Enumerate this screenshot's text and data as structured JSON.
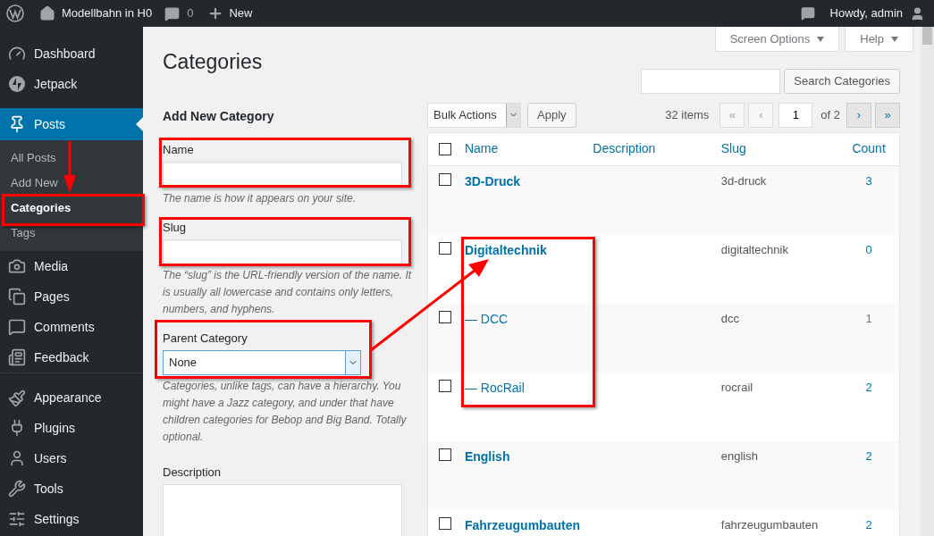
{
  "admin_bar": {
    "site_name": "Modellbahn in H0",
    "comments_count": "0",
    "new_label": "New",
    "greeting": "Howdy, admin"
  },
  "sidebar": {
    "items": [
      {
        "label": "Dashboard",
        "selected": false
      },
      {
        "label": "Jetpack",
        "selected": false
      },
      {
        "label": "Posts",
        "selected": true,
        "children": [
          {
            "label": "All Posts",
            "selected": false
          },
          {
            "label": "Add New",
            "selected": false
          },
          {
            "label": "Categories",
            "selected": true
          },
          {
            "label": "Tags",
            "selected": false
          }
        ]
      },
      {
        "label": "Media",
        "selected": false
      },
      {
        "label": "Pages",
        "selected": false
      },
      {
        "label": "Comments",
        "selected": false
      },
      {
        "label": "Feedback",
        "selected": false
      },
      {
        "label": "Appearance",
        "selected": false,
        "separator_before": true
      },
      {
        "label": "Plugins",
        "selected": false
      },
      {
        "label": "Users",
        "selected": false
      },
      {
        "label": "Tools",
        "selected": false
      },
      {
        "label": "Settings",
        "selected": false
      }
    ]
  },
  "screen_tabs": [
    "Screen Options",
    "Help"
  ],
  "page_title": "Categories",
  "add_form": {
    "heading": "Add New Category",
    "name": {
      "label": "Name",
      "hint": "The name is how it appears on your site."
    },
    "slug": {
      "label": "Slug",
      "hint": "The “slug” is the URL-friendly version of the name. It is usually all lowercase and contains only letters, numbers, and hyphens."
    },
    "parent": {
      "label": "Parent Category",
      "value": "None",
      "hint": "Categories, unlike tags, can have a hierarchy. You might have a Jazz category, and under that have children categories for Bebop and Big Band. Totally optional."
    },
    "description": {
      "label": "Description"
    }
  },
  "search": {
    "button": "Search Categories"
  },
  "bulk": {
    "value": "Bulk Actions",
    "apply": "Apply"
  },
  "pagination": {
    "items": "32 items",
    "page": "1",
    "of": "of 2",
    "buttons": [
      {
        "label": "«",
        "disabled": true
      },
      {
        "label": "‹",
        "disabled": true
      },
      {
        "label": "›",
        "disabled": false
      },
      {
        "label": "»",
        "disabled": false
      }
    ]
  },
  "table": {
    "columns": [
      "Name",
      "Description",
      "Slug",
      "Count"
    ],
    "select_all_checked": false,
    "rows": [
      {
        "name": "3D-Druck",
        "slug": "3d-druck",
        "count": "3",
        "count_linked": true,
        "checked": false
      },
      {
        "name": "Digitaltechnik",
        "slug": "digitaltechnik",
        "count": "0",
        "count_linked": true,
        "checked": false,
        "children": [
          {
            "name": "— DCC",
            "slug": "dcc",
            "count": "1",
            "count_linked": false,
            "checked": false
          },
          {
            "name": "— RocRail",
            "slug": "rocrail",
            "count": "2",
            "count_linked": true,
            "checked": false
          }
        ]
      },
      {
        "name": "English",
        "slug": "english",
        "count": "2",
        "count_linked": true,
        "checked": false
      },
      {
        "name": "Fahrzeugumbauten",
        "slug": "fahrzeugumbauten",
        "count": "2",
        "count_linked": true,
        "checked": false
      }
    ]
  }
}
